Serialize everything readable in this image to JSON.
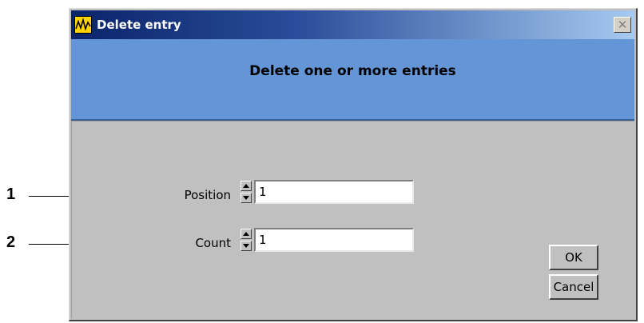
{
  "callouts": [
    "1",
    "2"
  ],
  "window": {
    "title": "Delete entry",
    "close_symbol": "✕"
  },
  "header": {
    "text": "Delete one or more entries"
  },
  "form": {
    "position": {
      "label": "Position",
      "value": "1"
    },
    "count": {
      "label": "Count",
      "value": "1"
    }
  },
  "buttons": {
    "ok": "OK",
    "cancel": "Cancel"
  },
  "icons": {
    "app": "labview-waveform-icon",
    "close": "close-icon",
    "spin_up": "spin-up-icon",
    "spin_down": "spin-down-icon"
  },
  "colors": {
    "title_start": "#0a246a",
    "title_end": "#a6caf0",
    "header_band": "#6495d6",
    "panel": "#c0c0c0"
  }
}
